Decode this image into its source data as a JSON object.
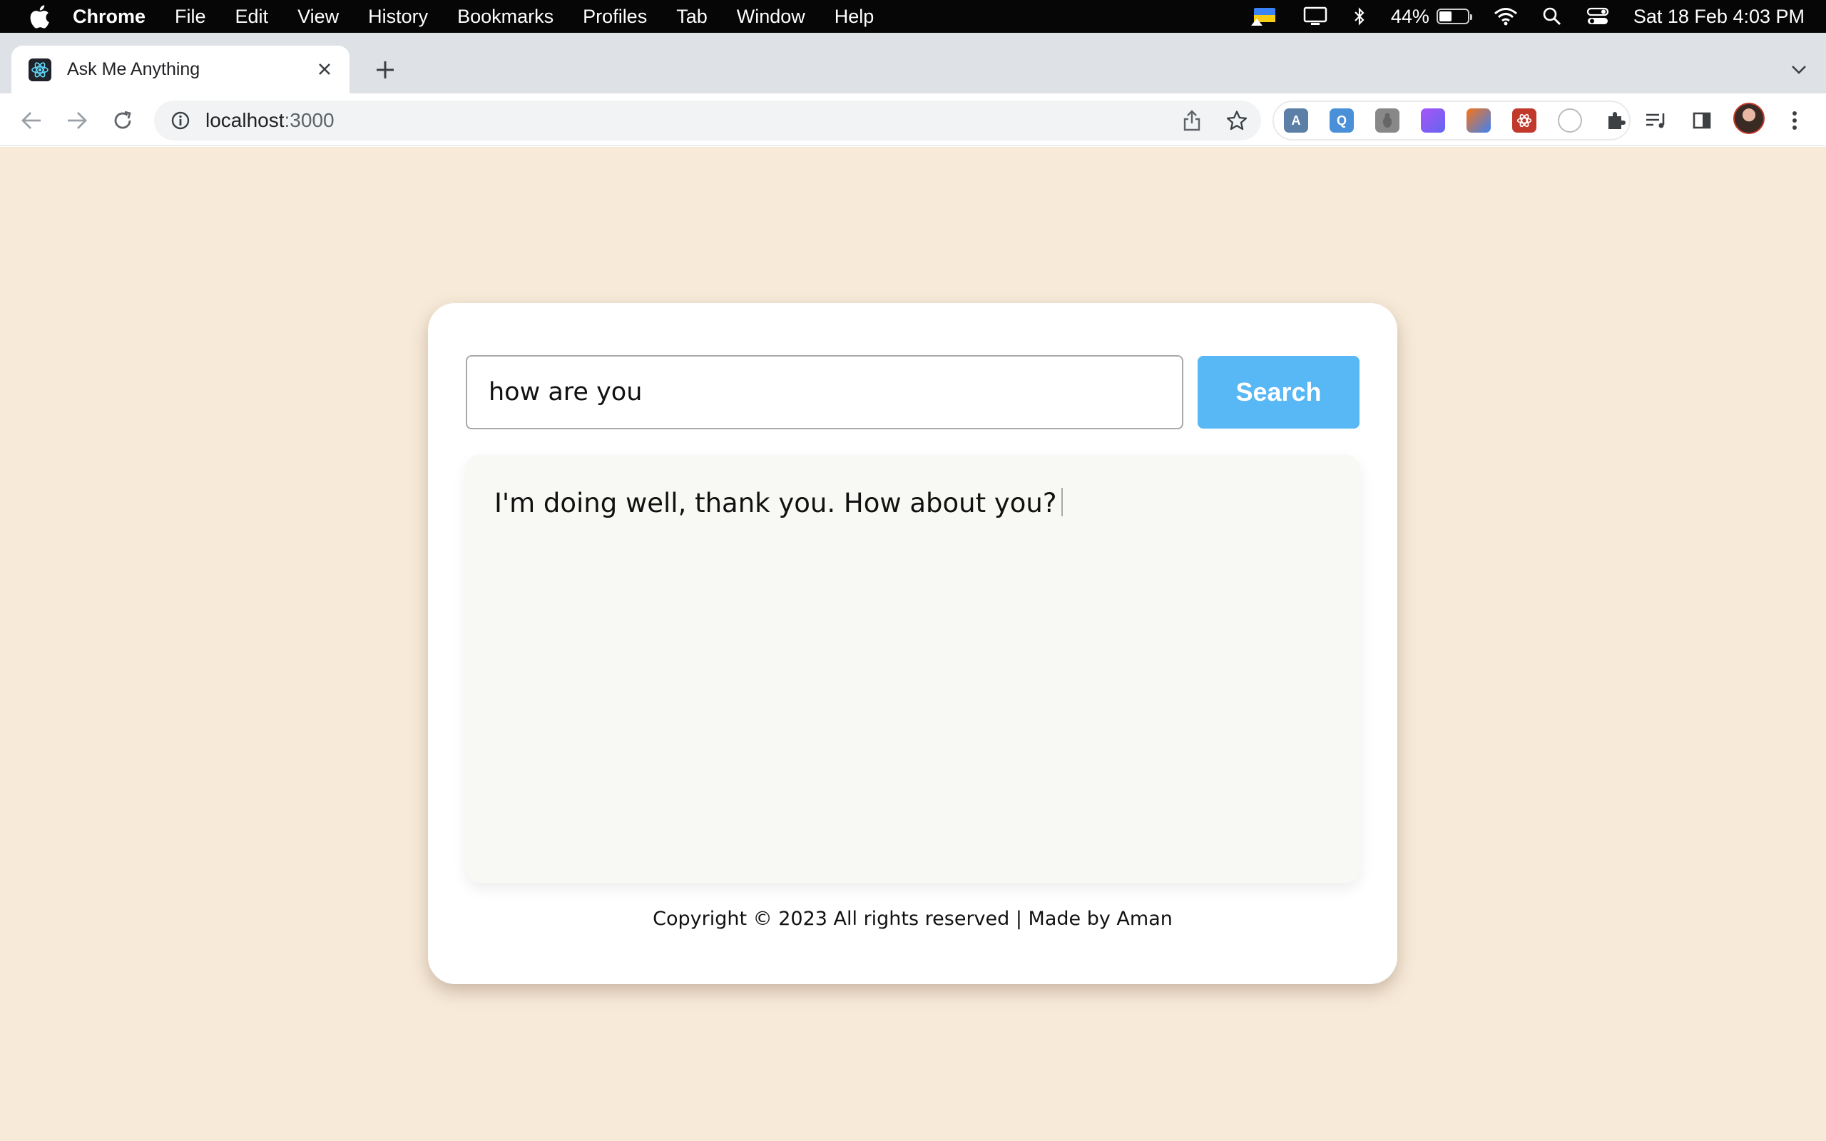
{
  "menubar": {
    "app_name": "Chrome",
    "items": [
      "File",
      "Edit",
      "View",
      "History",
      "Bookmarks",
      "Profiles",
      "Tab",
      "Window",
      "Help"
    ],
    "battery_percent": "44%",
    "battery_level": 0.44,
    "datetime": "Sat 18 Feb  4:03 PM"
  },
  "browser": {
    "tab_title": "Ask Me Anything",
    "url_host": "localhost",
    "url_port": ":3000",
    "extensions": [
      "A",
      "Q",
      "",
      "",
      "",
      "",
      ""
    ]
  },
  "app": {
    "search_query": "how are you",
    "search_button": "Search",
    "answer": "I'm doing well, thank you. How about you?",
    "footer": "Copyright © 2023 All rights reserved | Made by Aman"
  },
  "colors": {
    "page_bg": "#f7ead8",
    "card_bg": "#ffffff",
    "button_bg": "#58b7f5",
    "answer_bg": "#f8f8f4"
  }
}
